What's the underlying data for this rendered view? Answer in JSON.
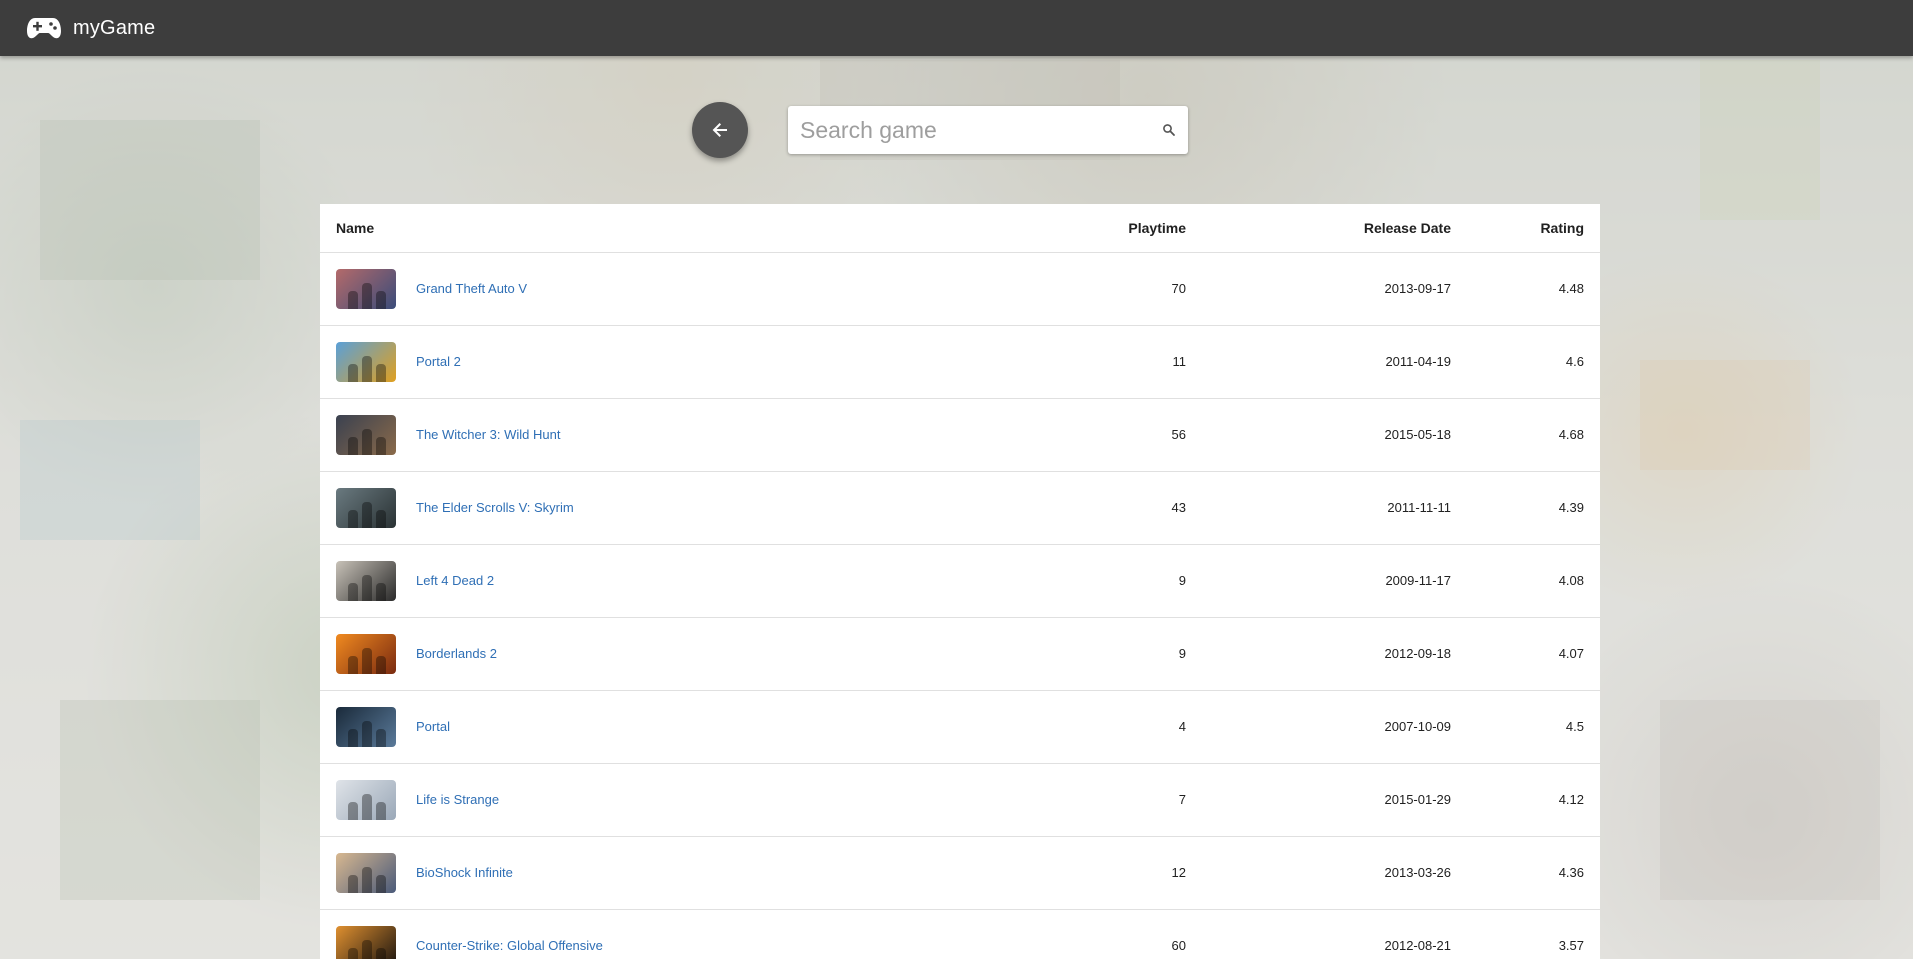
{
  "app": {
    "title": "myGame",
    "logo_icon": "gamepad-icon"
  },
  "back_button": {
    "icon": "arrow-left-icon"
  },
  "search": {
    "placeholder": "Search game",
    "value": "",
    "icon": "search-icon"
  },
  "table": {
    "headers": {
      "name": "Name",
      "playtime": "Playtime",
      "release_date": "Release Date",
      "rating": "Rating"
    },
    "rows": [
      {
        "name": "Grand Theft Auto V",
        "playtime": "70",
        "release_date": "2013-09-17",
        "rating": "4.48",
        "thumb_colors": [
          "#b46a6a",
          "#3a4c7a"
        ]
      },
      {
        "name": "Portal 2",
        "playtime": "11",
        "release_date": "2011-04-19",
        "rating": "4.6",
        "thumb_colors": [
          "#5aa0d8",
          "#e0a020"
        ]
      },
      {
        "name": "The Witcher 3: Wild Hunt",
        "playtime": "56",
        "release_date": "2015-05-18",
        "rating": "4.68",
        "thumb_colors": [
          "#3a4150",
          "#8a6a4a"
        ]
      },
      {
        "name": "The Elder Scrolls V: Skyrim",
        "playtime": "43",
        "release_date": "2011-11-11",
        "rating": "4.39",
        "thumb_colors": [
          "#6a7a80",
          "#2a3234"
        ]
      },
      {
        "name": "Left 4 Dead 2",
        "playtime": "9",
        "release_date": "2009-11-17",
        "rating": "4.08",
        "thumb_colors": [
          "#c8c2b8",
          "#2a2a2a"
        ]
      },
      {
        "name": "Borderlands 2",
        "playtime": "9",
        "release_date": "2012-09-18",
        "rating": "4.07",
        "thumb_colors": [
          "#f08a20",
          "#7a2a10"
        ]
      },
      {
        "name": "Portal",
        "playtime": "4",
        "release_date": "2007-10-09",
        "rating": "4.5",
        "thumb_colors": [
          "#1a2a3a",
          "#5a7a9a"
        ]
      },
      {
        "name": "Life is Strange",
        "playtime": "7",
        "release_date": "2015-01-29",
        "rating": "4.12",
        "thumb_colors": [
          "#dfe3e8",
          "#9aa8b8"
        ]
      },
      {
        "name": "BioShock Infinite",
        "playtime": "12",
        "release_date": "2013-03-26",
        "rating": "4.36",
        "thumb_colors": [
          "#d8b890",
          "#4a5a7a"
        ]
      },
      {
        "name": "Counter-Strike: Global Offensive",
        "playtime": "60",
        "release_date": "2012-08-21",
        "rating": "3.57",
        "thumb_colors": [
          "#e09030",
          "#1a1410"
        ]
      }
    ]
  },
  "colors": {
    "appbar": "#3d3d3d",
    "link": "#2f6fb5",
    "back_button": "#555555"
  }
}
